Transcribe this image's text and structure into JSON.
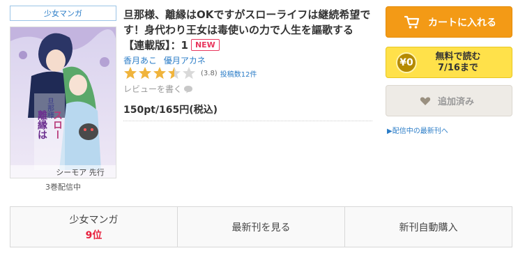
{
  "genre_tag": "少女マンガ",
  "cover": {
    "caption": "3巻配信中"
  },
  "book": {
    "title": "旦那様、離縁はOKですがスローライフは継続希望です！身代わり王女は毒使いの力で人生を謳歌する　【連載版】：1",
    "new_badge": "NEW",
    "authors": [
      "香月あこ",
      "優月アカネ"
    ],
    "rating": {
      "value": 3.8,
      "stars_full": 3,
      "stars_half": 1,
      "stars_empty": 1,
      "value_text": "(3.8)",
      "review_count_text": "投稿数12件"
    },
    "write_review": "レビューを書く",
    "price": "150pt/165円(税込)"
  },
  "actions": {
    "cart_label": "カートに入れる",
    "free_coin": "¥0",
    "free_text_line1": "無料で読む",
    "free_text_line2": "7/16まで",
    "added_label": "追加済み",
    "latest_link": "▶配信中の最新刊へ"
  },
  "bottom": {
    "rank_genre": "少女マンガ",
    "rank_value": "9位",
    "latest_label": "最新刊を見る",
    "auto_buy_label": "新刊自動購入"
  },
  "colors": {
    "accent_orange": "#f39a16",
    "free_yellow": "#ffe14a",
    "link_blue": "#2a7cc7",
    "new_red": "#e8365d",
    "star": "#f0b43c"
  }
}
